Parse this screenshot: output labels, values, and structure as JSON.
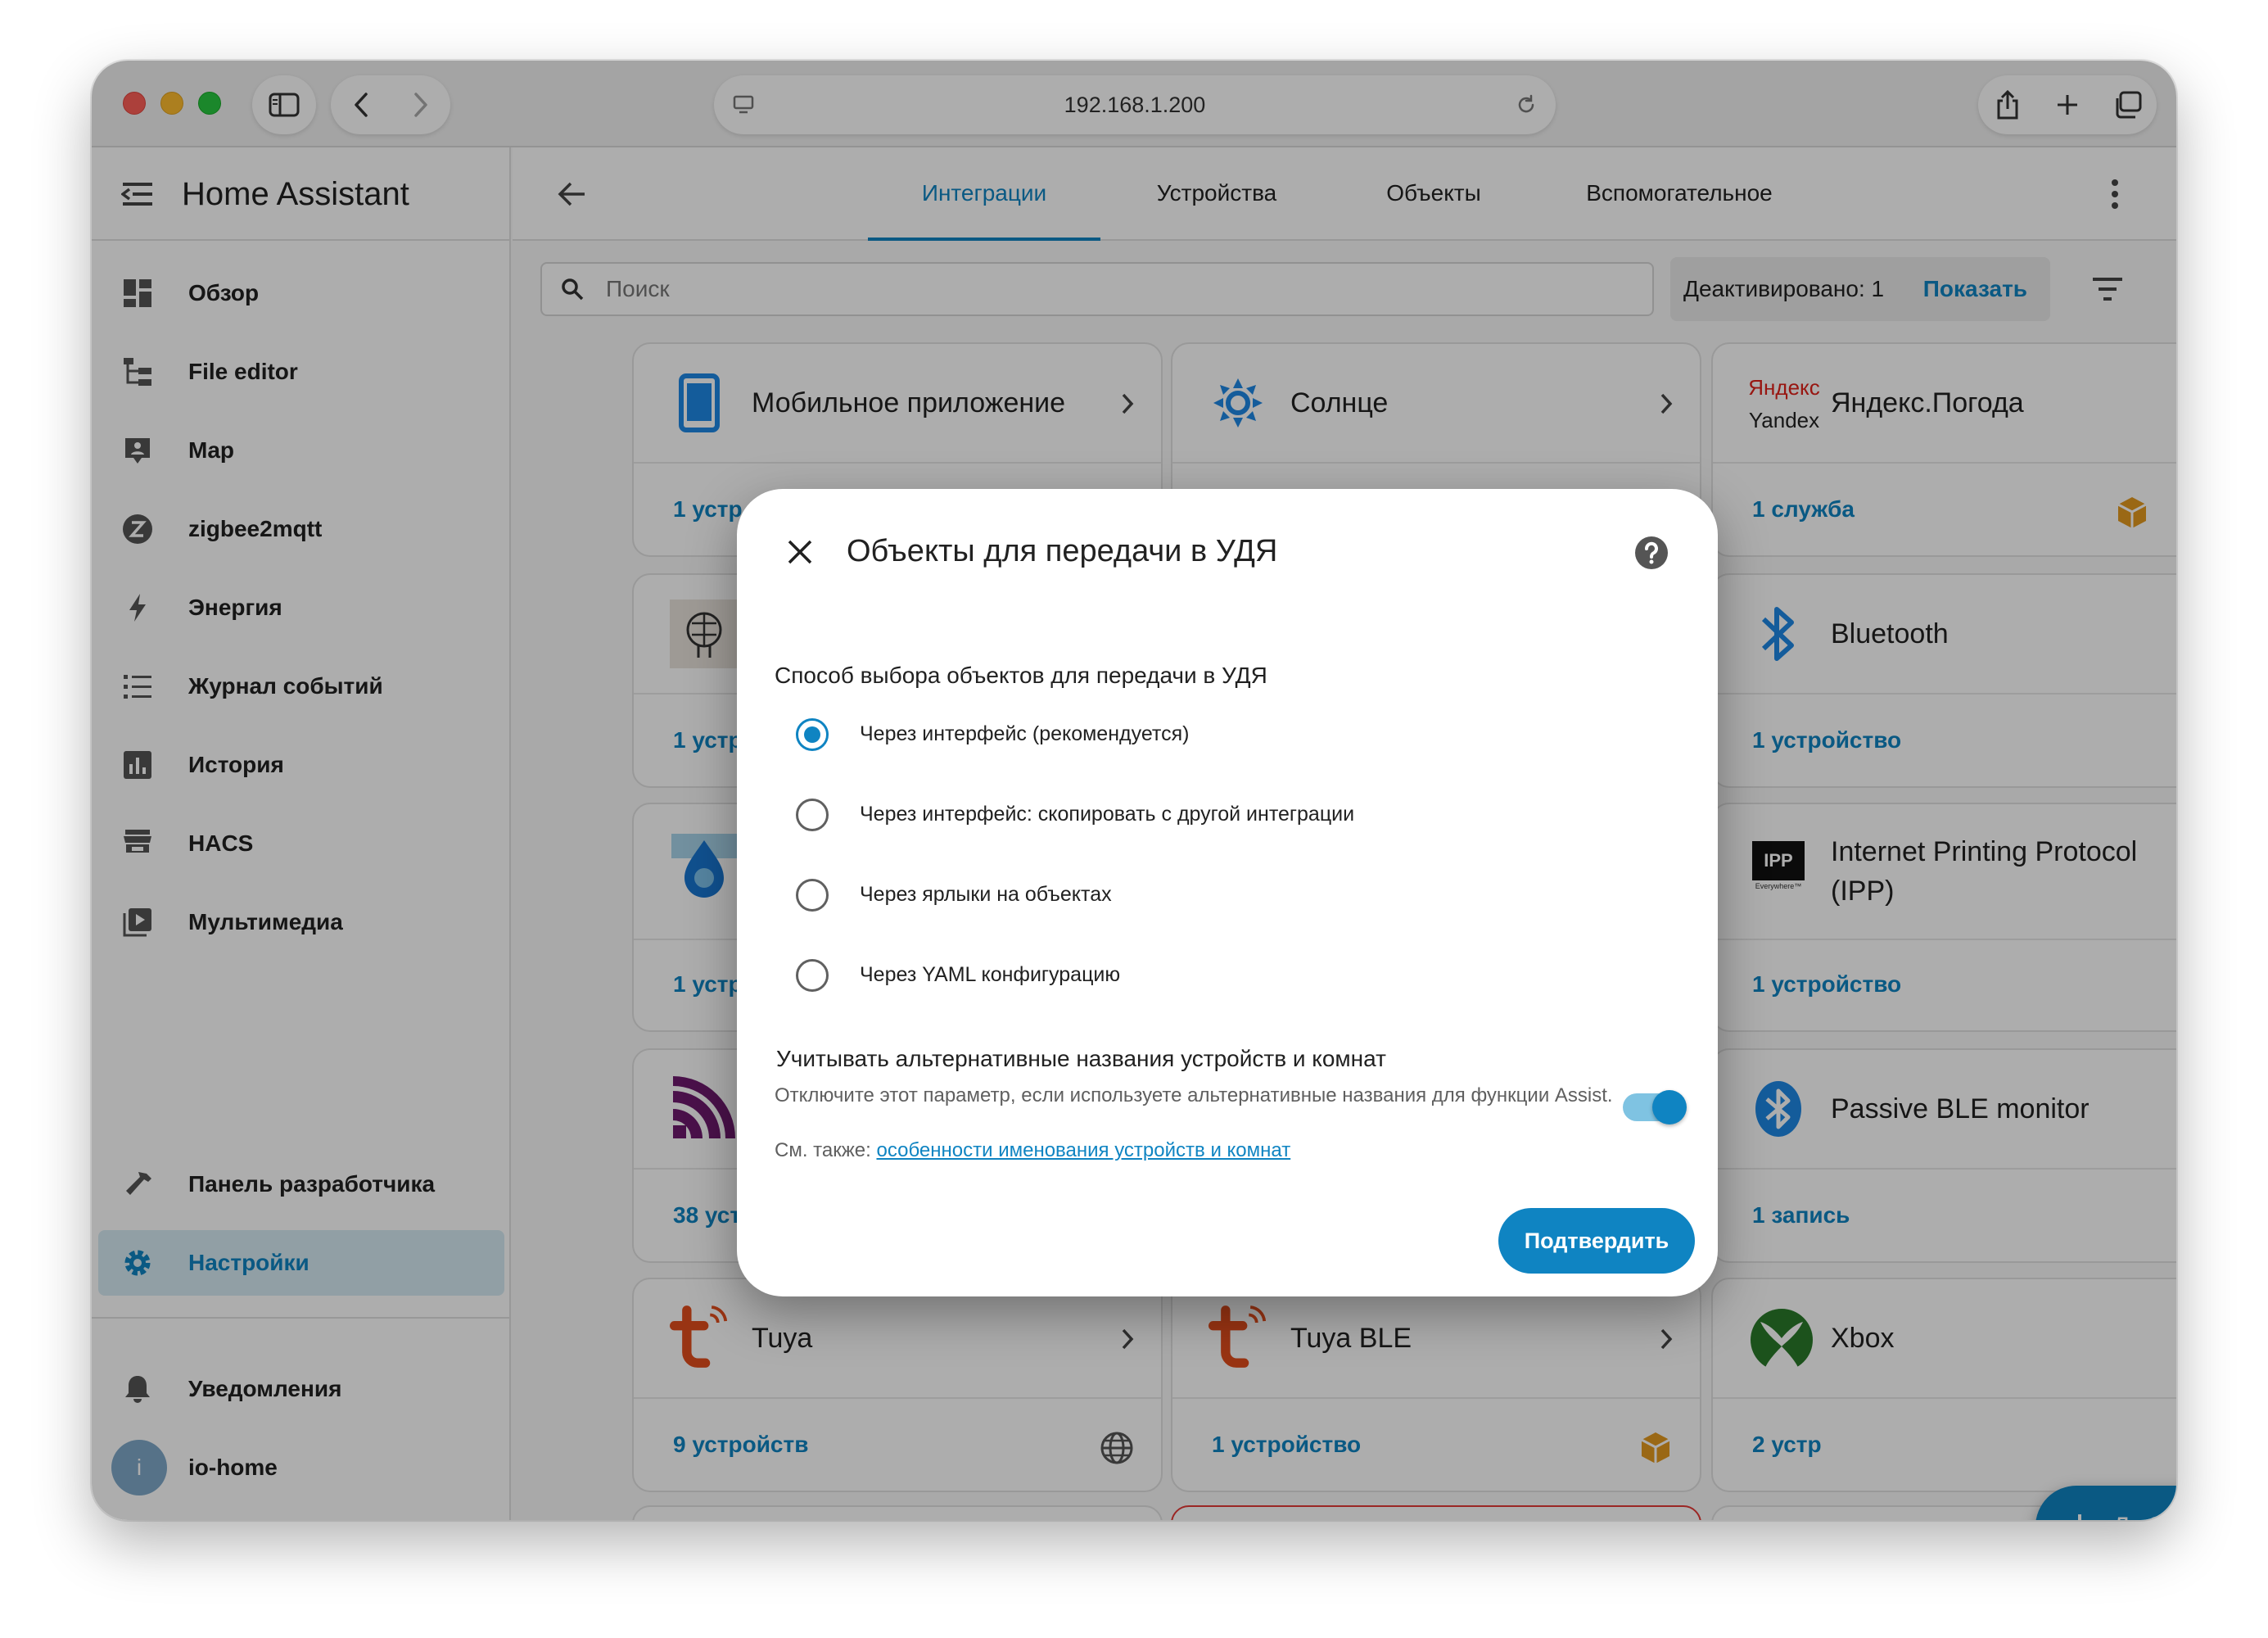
{
  "browser": {
    "url": "192.168.1.200"
  },
  "sidebar": {
    "title": "Home Assistant",
    "items": [
      {
        "label": "Обзор",
        "icon": "dashboard-icon"
      },
      {
        "label": "File editor",
        "icon": "file-tree-icon"
      },
      {
        "label": "Map",
        "icon": "map-icon"
      },
      {
        "label": "zigbee2mqtt",
        "icon": "zigbee-icon"
      },
      {
        "label": "Энергия",
        "icon": "lightning-icon"
      },
      {
        "label": "Журнал событий",
        "icon": "list-icon"
      },
      {
        "label": "История",
        "icon": "chart-icon"
      },
      {
        "label": "HACS",
        "icon": "hacs-icon"
      },
      {
        "label": "Мультимедиа",
        "icon": "media-icon"
      }
    ],
    "dev_tools": "Панель разработчика",
    "settings": "Настройки",
    "notifications": "Уведомления",
    "user": {
      "initial": "i",
      "name": "io-home"
    }
  },
  "topbar": {
    "tabs": [
      "Интеграции",
      "Устройства",
      "Объекты",
      "Вспомогательное"
    ],
    "active_tab": 0
  },
  "search": {
    "placeholder": "Поиск",
    "deactivated": "Деактивировано: 1",
    "show": "Показать"
  },
  "cards": [
    {
      "title": "Мобильное приложение",
      "footer": "1 устр"
    },
    {
      "title": "Солнце",
      "footer": ""
    },
    {
      "title": "Яндекс.Погода",
      "footer": "1 служба",
      "logo_line1": "Яндекс",
      "logo_line2": "Yandex"
    },
    {
      "title": "",
      "footer": "1 устр"
    },
    {
      "title": "Bluetooth",
      "footer": "1 устройство"
    },
    {
      "title": "",
      "footer": "1 устр"
    },
    {
      "title": "Internet Printing Protocol (IPP)",
      "footer": "1 устройство",
      "logo_text": "IPP",
      "logo_sub": "Everywhere™"
    },
    {
      "title": "",
      "footer": "38 уст"
    },
    {
      "title": "Passive BLE monitor",
      "footer": "1 запись"
    },
    {
      "title": "Tuya",
      "footer": "9 устройств"
    },
    {
      "title": "Tuya BLE",
      "footer": "1 устройство"
    },
    {
      "title": "Xbox",
      "footer": "2 устр"
    }
  ],
  "fab": {
    "label": "Добавить интеграцию"
  },
  "dialog": {
    "title": "Объекты для передачи в УДЯ",
    "subtitle": "Способ выбора объектов для передачи в УДЯ",
    "options": [
      "Через интерфейс (рекомендуется)",
      "Через интерфейс: скопировать с другой интеграции",
      "Через ярлыки на объектах",
      "Через YAML конфигурацию"
    ],
    "selected_option": 0,
    "toggle_title": "Учитывать альтернативные названия устройств и комнат",
    "toggle_desc": "Отключите этот параметр, если используете альтернативные названия для функции Assist.",
    "toggle_see_prefix": "См. также: ",
    "toggle_link": "особенности именования устройств и комнат",
    "toggle_on": true,
    "confirm": "Подтвердить"
  },
  "colors": {
    "accent": "#0f84c2",
    "tuya": "#e24d1c",
    "xbox": "#2a7a2a",
    "package_badge": "#e39a1f"
  }
}
